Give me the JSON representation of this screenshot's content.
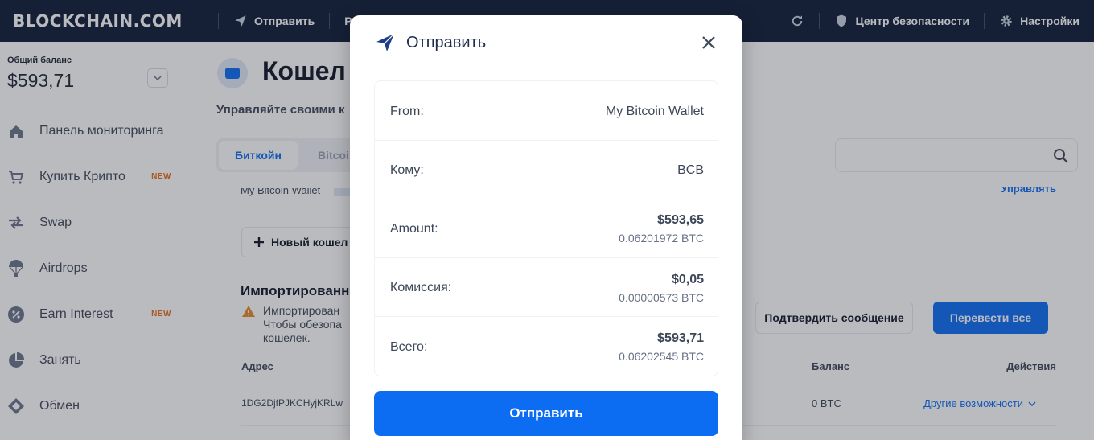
{
  "topbar": {
    "logo": "BLOCKCHAIN.COM",
    "send_label": "Отправить",
    "receive_label": "Р",
    "security_label": "Центр безопасности",
    "settings_label": "Настройки"
  },
  "sidebar": {
    "balance_label": "Общий баланс",
    "balance_value": "$593,71",
    "items": [
      {
        "label": "Панель мониторинга",
        "icon": "home-icon"
      },
      {
        "label": "Купить Крипто",
        "icon": "cart-icon",
        "badge": "NEW"
      },
      {
        "label": "Swap",
        "icon": "swap-icon"
      },
      {
        "label": "Airdrops",
        "icon": "parachute-icon"
      },
      {
        "label": "Earn Interest",
        "icon": "percent-icon",
        "badge": "NEW"
      },
      {
        "label": "Занять",
        "icon": "pie-icon"
      },
      {
        "label": "Обмен",
        "icon": "exchange-icon"
      }
    ]
  },
  "main": {
    "title": "Кошел",
    "subtitle": "Управляйте своими к",
    "tabs": [
      "Биткойн",
      "Bitcoi"
    ],
    "wallet_row_text": "My Bitcoin Wallet",
    "manage_link": "Управлять",
    "new_wallet_label": "Новый кошел",
    "imported_heading": "Импортированны",
    "warning_line1": "Импортирован",
    "warning_line2": "Чтобы обезопа",
    "warning_line3": "кошелек.",
    "confirm_message_button": "Подтвердить сообщение",
    "transfer_all_button": "Перевести все",
    "col_address": "Адрес",
    "col_balance": "Баланс",
    "col_actions": "Действия",
    "row_address": "1DG2DjfPJKCHyjKRLw",
    "row_balance": "0 BTC",
    "row_more": "Другие возможности"
  },
  "modal": {
    "title": "Отправить",
    "rows": [
      {
        "label": "From:",
        "value": "My Bitcoin Wallet"
      },
      {
        "label": "Кому:",
        "value": "BCB"
      },
      {
        "label": "Amount:",
        "fiat": "$593,65",
        "crypto": "0.06201972 BTC"
      },
      {
        "label": "Комиссия:",
        "fiat": "$0,05",
        "crypto": "0.00000573 BTC"
      },
      {
        "label": "Всего:",
        "fiat": "$593,71",
        "crypto": "0.06202545 BTC"
      }
    ],
    "send_button": "Отправить"
  },
  "colors": {
    "topbar_bg": "#0d1b36",
    "accent": "#0c6cf2",
    "badge": "#e66c1a"
  }
}
